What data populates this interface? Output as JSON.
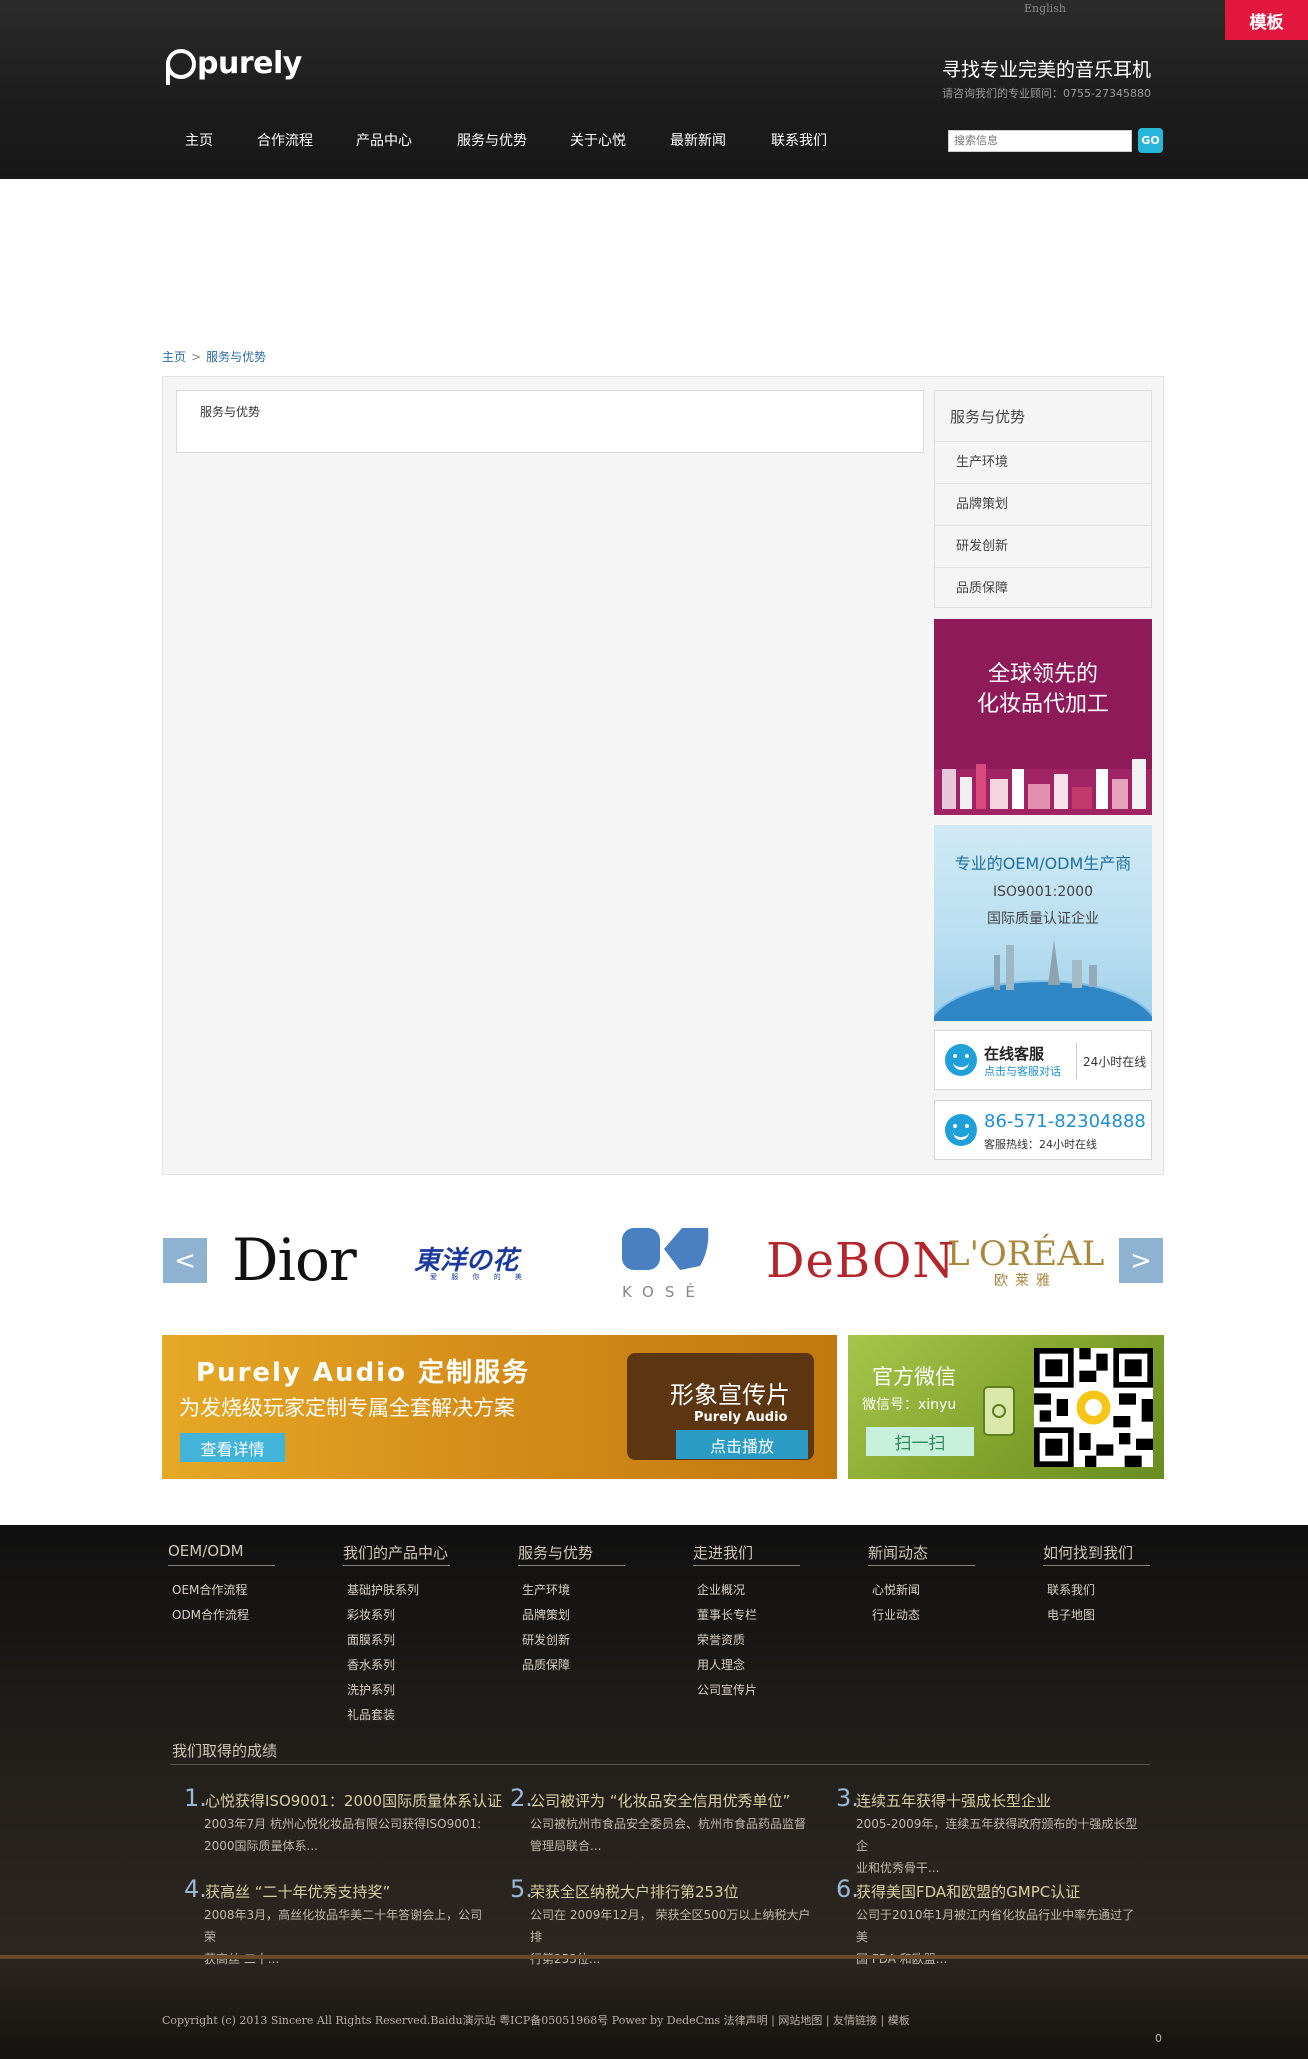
{
  "header": {
    "lang": "English",
    "ribbon": "模板",
    "logo": "purely",
    "slogan": "寻找专业完美的音乐耳机",
    "consult": "请咨询我们的专业顾问：0755-27345880",
    "nav": [
      "主页",
      "合作流程",
      "产品中心",
      "服务与优势",
      "关于心悦",
      "最新新闻",
      "联系我们"
    ],
    "search_placeholder": "搜索信息",
    "search_button": "GO"
  },
  "breadcrumb": {
    "home": "主页",
    "sep": ">",
    "current": "服务与优势"
  },
  "content": {
    "title": "服务与优势"
  },
  "sidebar": {
    "title": "服务与优势",
    "items": [
      "生产环境",
      "品牌策划",
      "研发创新",
      "品质保障"
    ],
    "promo1": {
      "line1": "全球领先的",
      "line2": "化妆品代加工"
    },
    "promo2": {
      "title": "专业的OEM/ODM生产商",
      "sub1": "ISO9001:2000",
      "sub2": "国际质量认证企业"
    },
    "service1": {
      "title": "在线客服",
      "sub": "点击与客服对话",
      "hours": "24小时在线"
    },
    "service2": {
      "phone": "86-571-82304888",
      "sub": "客服热线：24小时在线"
    }
  },
  "brands": {
    "prev": "<",
    "next": ">",
    "dior": "Dior",
    "toyo": "東洋の花",
    "toyo_sub": "爱 服 你 的 美",
    "kose": "KOSÉ",
    "debon": "DeBON",
    "loreal": "L'ORÉAL",
    "loreal_sub": "欧莱雅"
  },
  "banner1": {
    "title": "Purely Audio 定制服务",
    "sub": "为发烧级玩家定制专属全套解决方案",
    "button": "查看详情",
    "film_title": "形象宣传片",
    "film_sub": "Purely Audio",
    "film_button": "点击播放"
  },
  "banner2": {
    "title": "官方微信",
    "wx": "微信号：xinyu",
    "button": "扫一扫"
  },
  "footer": {
    "columns": [
      {
        "title": "OEM/ODM",
        "links": [
          "OEM合作流程",
          "ODM合作流程"
        ]
      },
      {
        "title": "我们的产品中心",
        "links": [
          "基础护肤系列",
          "彩妆系列",
          "面膜系列",
          "香水系列",
          "洗护系列",
          "礼品套装"
        ]
      },
      {
        "title": "服务与优势",
        "links": [
          "生产环境",
          "品牌策划",
          "研发创新",
          "品质保障"
        ]
      },
      {
        "title": "走进我们",
        "links": [
          "企业概况",
          "董事长专栏",
          "荣誉资质",
          "用人理念",
          "公司宣传片"
        ]
      },
      {
        "title": "新闻动态",
        "links": [
          "心悦新闻",
          "行业动态"
        ]
      },
      {
        "title": "如何找到我们",
        "links": [
          "联系我们",
          "电子地图"
        ]
      }
    ],
    "achievements_title": "我们取得的成绩",
    "achievements": [
      {
        "num": "1.",
        "title": "心悦获得ISO9001：2000国际质量体系认证",
        "desc1": "2003年7月 杭州心悦化妆品有限公司获得ISO9001:",
        "desc2": "2000国际质量体系..."
      },
      {
        "num": "2.",
        "title": "公司被评为 “化妆品安全信用优秀单位”",
        "desc1": "公司被杭州市食品安全委员会、杭州市食品药品监督",
        "desc2": "管理局联合..."
      },
      {
        "num": "3.",
        "title": "连续五年获得十强成长型企业",
        "desc1": "2005-2009年，连续五年获得政府颁布的十强成长型企",
        "desc2": "业和优秀骨干..."
      },
      {
        "num": "4.",
        "title": "获高丝 “二十年优秀支持奖”",
        "desc1": "2008年3月，高丝化妆品华美二十年答谢会上，公司荣",
        "desc2": "获高丝 二十..."
      },
      {
        "num": "5.",
        "title": "荣获全区纳税大户排行第253位",
        "desc1": "公司在 2009年12月， 荣获全区500万以上纳税大户排",
        "desc2": "行第253位..."
      },
      {
        "num": "6.",
        "title": "获得美国FDA和欧盟的GMPC认证",
        "desc1": "公司于2010年1月被江内省化妆品行业中率先通过了美",
        "desc2": "国 FDA 和欧盟..."
      }
    ],
    "copyright": "Copyright (c) 2013 Sincere All Rights Reserved.Baidu演示站 粤ICP备05051968号 Power by DedeCms 法律声明 | 网站地图 | 友情链接 | 模板",
    "counter": "0"
  },
  "colors": {
    "ribbon": "#e3173d",
    "link": "#2c6aa3",
    "promo1": "#8e1a59",
    "service_blue": "#1e8fd0"
  }
}
